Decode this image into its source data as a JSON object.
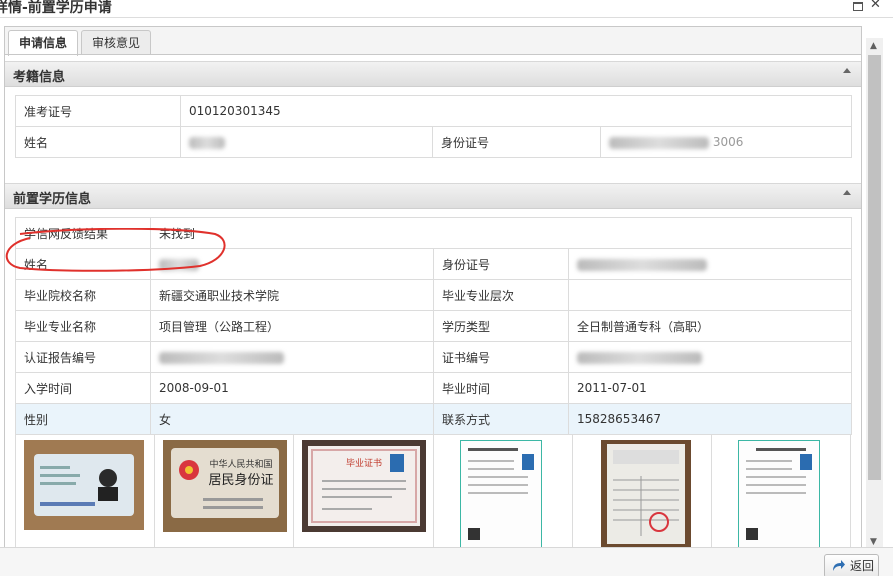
{
  "window": {
    "title": "详情-前置学历申请"
  },
  "tabs": [
    {
      "label": "申请信息"
    },
    {
      "label": "审核意见"
    }
  ],
  "exam_section": {
    "title": "考籍信息",
    "rows": {
      "exam_no_label": "准考证号",
      "exam_no_value": "010120301345",
      "name_label": "姓名",
      "id_label": "身份证号",
      "id_tail": "3006"
    }
  },
  "edu_section": {
    "title": "前置学历信息",
    "rows": [
      {
        "l1": "学信网反馈结果",
        "v1": "未找到"
      },
      {
        "l1": "姓名",
        "v1": "",
        "l2": "身份证号",
        "v2": ""
      },
      {
        "l1": "毕业院校名称",
        "v1": "新疆交通职业技术学院",
        "l2": "毕业专业层次",
        "v2": ""
      },
      {
        "l1": "毕业专业名称",
        "v1": "项目管理（公路工程）",
        "l2": "学历类型",
        "v2": "全日制普通专科（高职）"
      },
      {
        "l1": "认证报告编号",
        "v1": "",
        "l2": "证书编号",
        "v2": ""
      },
      {
        "l1": "入学时间",
        "v1": "2008-09-01",
        "l2": "毕业时间",
        "v2": "2011-07-01"
      },
      {
        "l1": "性别",
        "v1": "女",
        "l2": "联系方式",
        "v2": "15828653467"
      }
    ],
    "photos": [
      {
        "kind": "id-card-front-icon"
      },
      {
        "kind": "id-card-back-icon",
        "card_title": "中华人民共和国",
        "card_sub": "居民身份证"
      },
      {
        "kind": "diploma-icon",
        "caption": "毕业证书"
      },
      {
        "kind": "report-doc-icon"
      },
      {
        "kind": "register-form-icon"
      },
      {
        "kind": "report-doc-icon"
      }
    ]
  },
  "footer": {
    "back_label": "返回"
  }
}
